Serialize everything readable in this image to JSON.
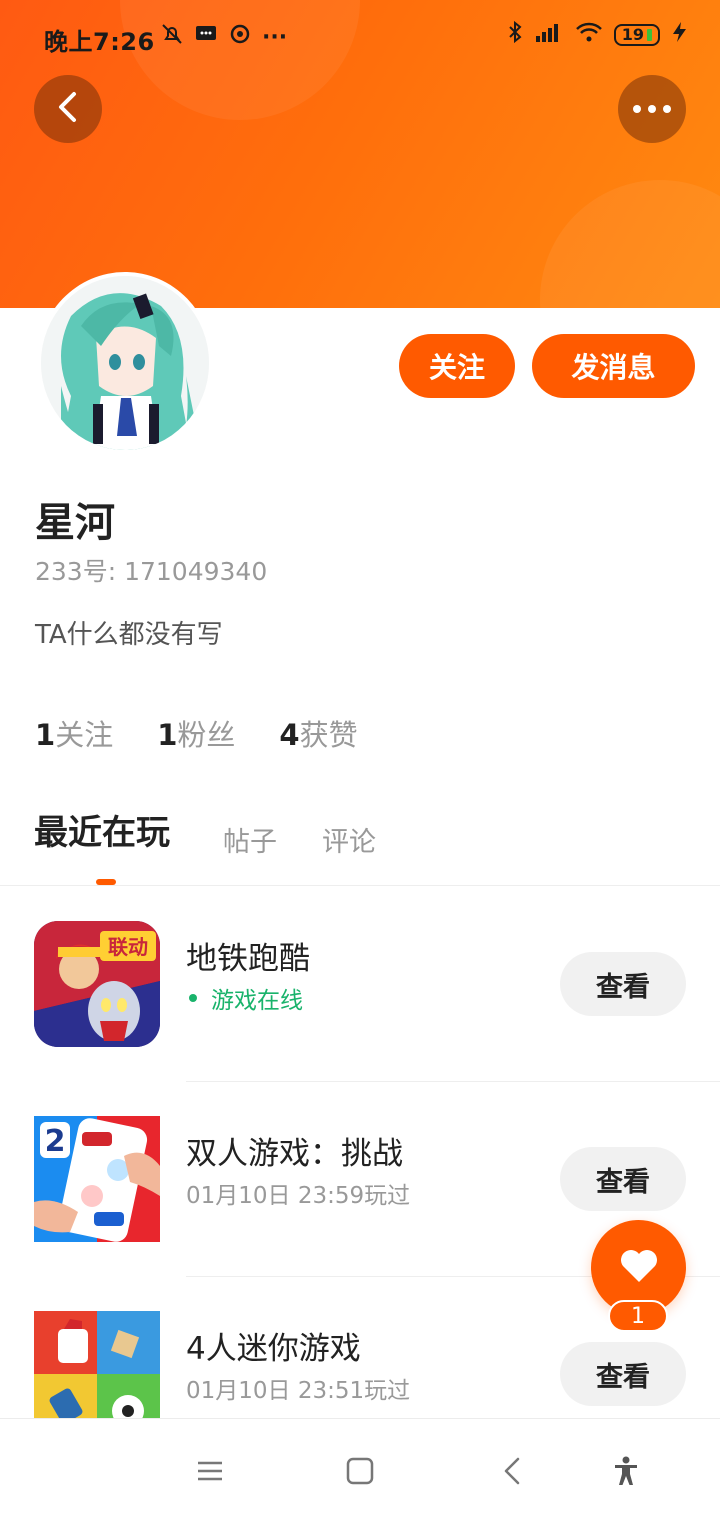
{
  "status_bar": {
    "time": "晚上7:26",
    "battery_level": "19"
  },
  "profile": {
    "name": "星河",
    "id_text": "233号: 171049340",
    "bio": "TA什么都没有写",
    "follow_label": "关注",
    "message_label": "发消息"
  },
  "stats": [
    {
      "value": "1",
      "label": "关注"
    },
    {
      "value": "1",
      "label": "粉丝"
    },
    {
      "value": "4",
      "label": "获赞"
    }
  ],
  "tabs": [
    {
      "label": "最近在玩",
      "active": true
    },
    {
      "label": "帖子",
      "active": false
    },
    {
      "label": "评论",
      "active": false
    }
  ],
  "games": [
    {
      "name": "地铁跑酷",
      "status": "游戏在线",
      "online": true,
      "button": "查看"
    },
    {
      "name": "双人游戏：挑战",
      "status": "01月10日 23:59玩过",
      "online": false,
      "button": "查看"
    },
    {
      "name": "4人迷你游戏",
      "status": "01月10日 23:51玩过",
      "online": false,
      "button": "查看"
    }
  ],
  "game_icon_text": {
    "game0_badge": "联动",
    "game1_badge": "2"
  },
  "fab": {
    "badge_count": "1",
    "icon": "heart-icon"
  },
  "colors": {
    "accent": "#ff5a00",
    "online": "#19b36b"
  }
}
